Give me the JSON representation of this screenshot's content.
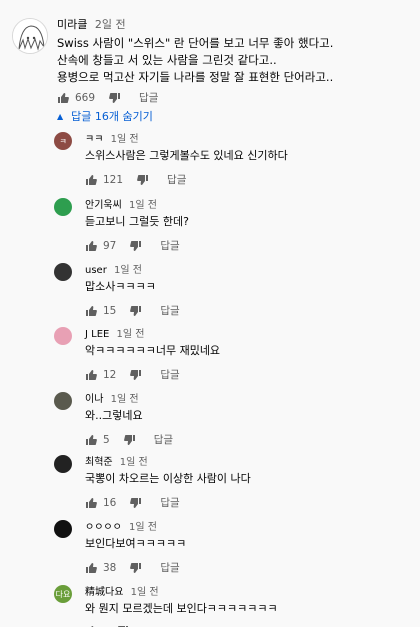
{
  "comment": {
    "author": "미라클",
    "time": "2일 전",
    "lines": [
      "Swiss 사람이 \"스위스\" 란 단어를 보고 너무 좋아 했다고.",
      "산속에 창들고 서 있는 사람을 그린것 같다고..",
      "용병으로 먹고산 자기들 나라를 정말 잘 표현한 단어라고.."
    ],
    "likes": "669",
    "reply_label": "답글"
  },
  "replies_toggle": "답글 16개 숨기기",
  "replies": [
    {
      "author": "ㅋㅋ",
      "time": "1일 전",
      "text": "스위스사람은 그렇게볼수도 있네요 신기하다",
      "likes": "121",
      "reply_label": "답글",
      "avatar_text": "ㅋ",
      "avatar_color": "#8d4b44"
    },
    {
      "author": "안기욱씨",
      "time": "1일 전",
      "text": "듣고보니 그럴듯 한데?",
      "likes": "97",
      "reply_label": "답글",
      "avatar_text": "",
      "avatar_color": "#2e9e4f"
    },
    {
      "author": "user",
      "time": "1일 전",
      "text": "맙소사ㅋㅋㅋㅋ",
      "likes": "15",
      "reply_label": "답글",
      "avatar_text": "",
      "avatar_color": "#333333"
    },
    {
      "author": "J LEE",
      "time": "1일 전",
      "text": "악ㅋㅋㅋㅋㅋㅋ너무 재밌네요",
      "likes": "12",
      "reply_label": "답글",
      "avatar_text": "",
      "avatar_color": "#e8a0b4"
    },
    {
      "author": "이나",
      "time": "1일 전",
      "text": "와..그렇네요",
      "likes": "5",
      "reply_label": "답글",
      "avatar_text": "",
      "avatar_color": "#5a5a4e"
    },
    {
      "author": "최혁준",
      "time": "1일 전",
      "text": "국뽕이 차오르는 이상한 사람이 나다",
      "likes": "16",
      "reply_label": "답글",
      "avatar_text": "",
      "avatar_color": "#222222"
    },
    {
      "author": "ㅇㅇㅇㅇ",
      "time": "1일 전",
      "text": "보인다보여ㅋㅋㅋㅋㅋ",
      "likes": "38",
      "reply_label": "답글",
      "avatar_text": "",
      "avatar_color": "#111111"
    },
    {
      "author": "精城다요",
      "time": "1일 전",
      "text": "와 뭔지 모르겠는데 보인다ㅋㅋㅋㅋㅋㅋㅋ",
      "likes": "",
      "reply_label": "",
      "avatar_text": "다요",
      "avatar_color": "#6a9e3a"
    }
  ],
  "colors": {
    "link": "#065fd4",
    "meta": "#606060",
    "background": "#f9f9f9"
  }
}
